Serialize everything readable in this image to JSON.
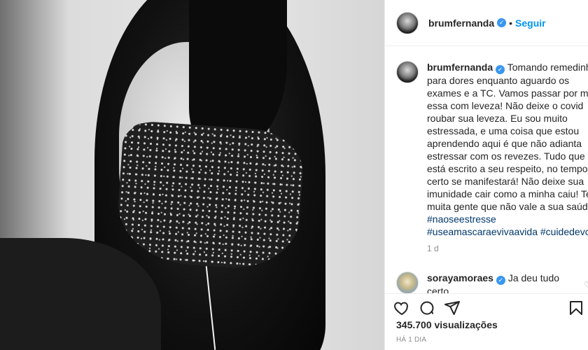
{
  "post": {
    "author": "brumfernanda",
    "follow_label": "Seguir",
    "dot": "•",
    "caption_lines": [
      "Tomando remedinhos",
      "para dores enquanto aguardo os",
      "exames e a TC. Vamos passar por mais",
      "essa com leveza! Não deixe o covid",
      "roubar sua leveza. Eu sou muito",
      "estressada, e uma coisa que estou",
      "aprendendo aqui é que não adianta",
      "estressar com os revezes. Tudo que",
      "está escrito a seu respeito, no tempo",
      "certo se manifestará! Não deixe sua",
      "imunidade cair como a minha caiu! Tem",
      "muita gente que não vale a sua saúde."
    ],
    "hashtags": [
      "#naoseestresse",
      "#useamascaraevivaavida",
      "#cuidedevc"
    ],
    "caption_age": "1 d",
    "comments": [
      {
        "user": "sorayamoraes",
        "text_line1": "Ja deu tudo",
        "text_line2": "certo"
      }
    ],
    "views": "345.700 visualizações",
    "posted": "HÁ 1 DIA"
  },
  "icons": {
    "like": "heart-icon",
    "comment": "comment-icon",
    "share": "paper-plane-icon",
    "save": "bookmark-icon",
    "verified": "verified-badge-icon"
  },
  "colors": {
    "link_blue": "#0095f6",
    "hashtag": "#00376b",
    "verified": "#3897f0",
    "muted": "#8e8e8e"
  }
}
